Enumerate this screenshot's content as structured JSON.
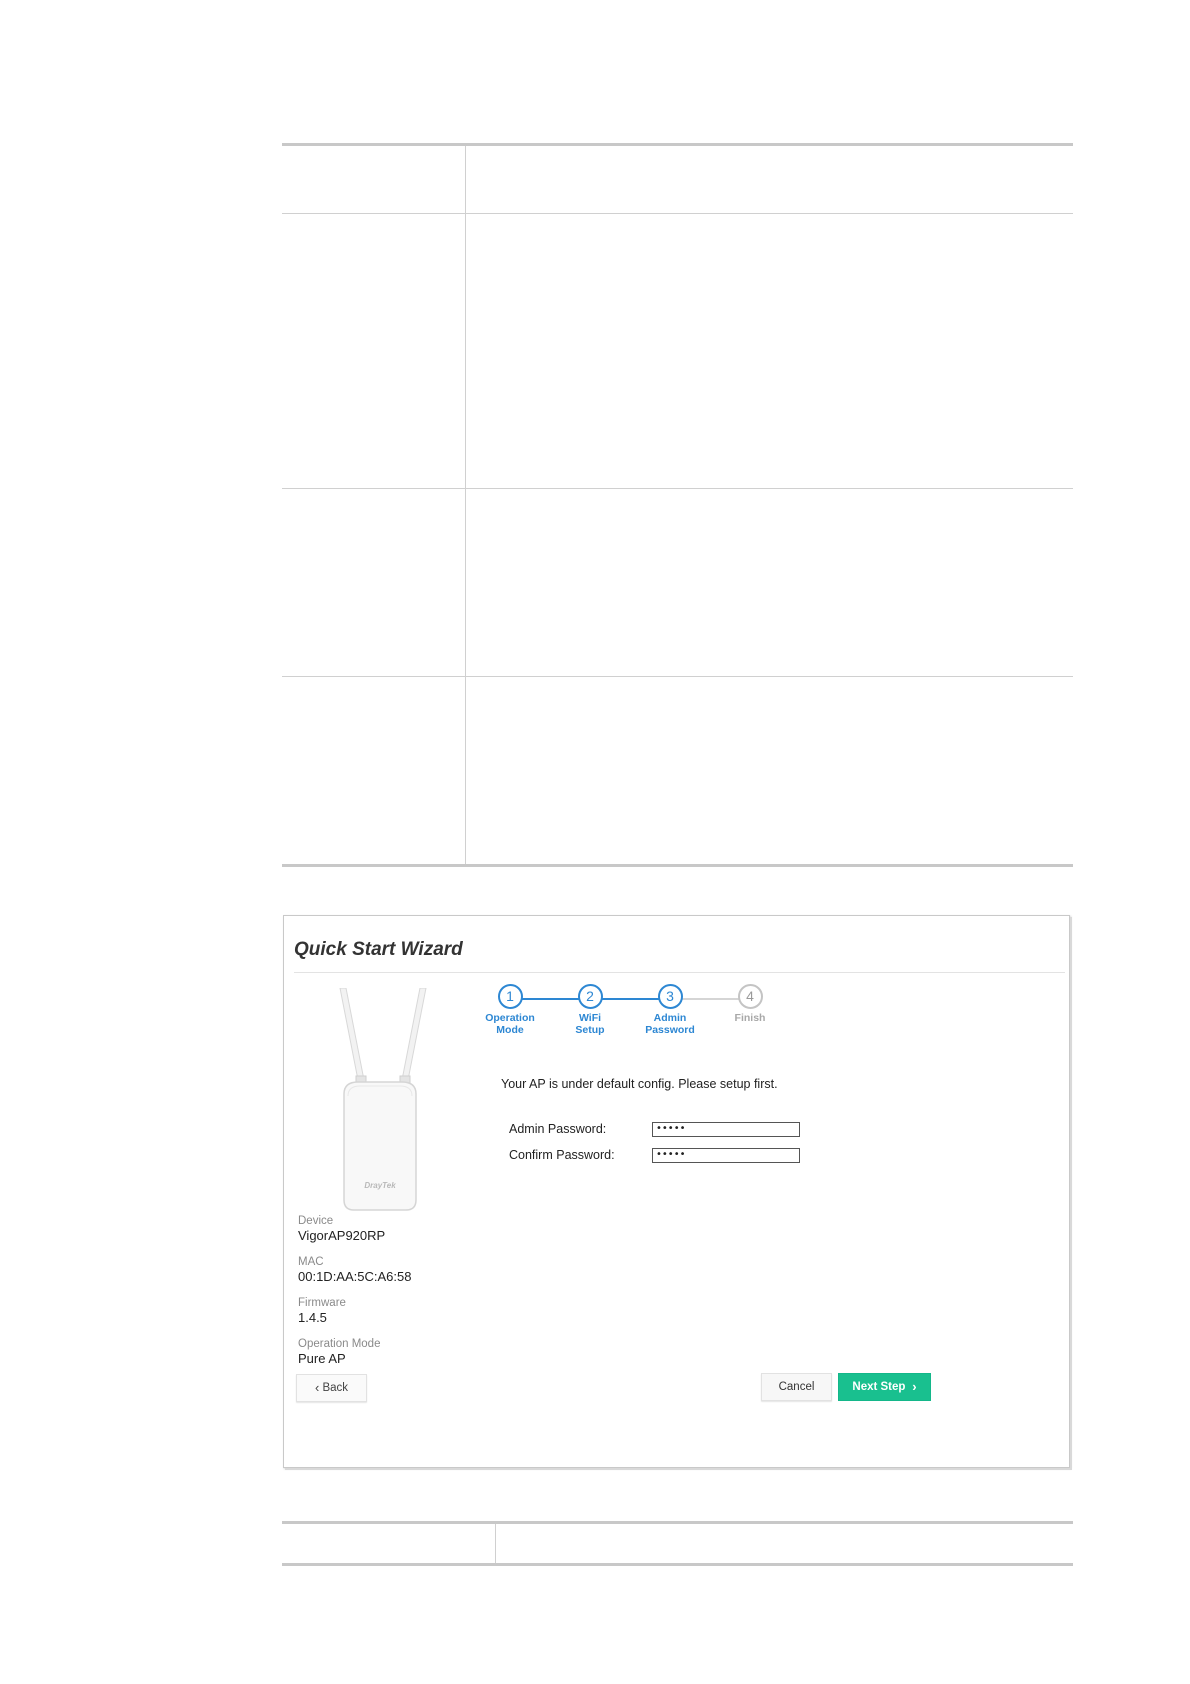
{
  "wizard": {
    "title": "Quick Start Wizard",
    "brand": "DrayTek",
    "steps": [
      {
        "number": "1",
        "label_line1": "Operation",
        "label_line2": "Mode",
        "state": "done"
      },
      {
        "number": "2",
        "label_line1": "WiFi",
        "label_line2": "Setup",
        "state": "done"
      },
      {
        "number": "3",
        "label_line1": "Admin",
        "label_line2": "Password",
        "state": "current"
      },
      {
        "number": "4",
        "label_line1": "Finish",
        "label_line2": "",
        "state": "pending"
      }
    ],
    "notice": "Your AP is under default config. Please setup first.",
    "fields": {
      "admin_password_label": "Admin Password:",
      "admin_password_value": "•••••",
      "confirm_password_label": "Confirm Password:",
      "confirm_password_value": "•••••"
    },
    "device_info": {
      "device_label": "Device",
      "device_value": "VigorAP920RP",
      "mac_label": "MAC",
      "mac_value": "00:1D:AA:5C:A6:58",
      "firmware_label": "Firmware",
      "firmware_value": "1.4.5",
      "mode_label": "Operation Mode",
      "mode_value": "Pure AP"
    },
    "buttons": {
      "back": "Back",
      "cancel": "Cancel",
      "next": "Next Step"
    },
    "colors": {
      "accent": "#2d87d3",
      "next_button": "#19c08f",
      "inactive": "#c4c4c4"
    }
  }
}
